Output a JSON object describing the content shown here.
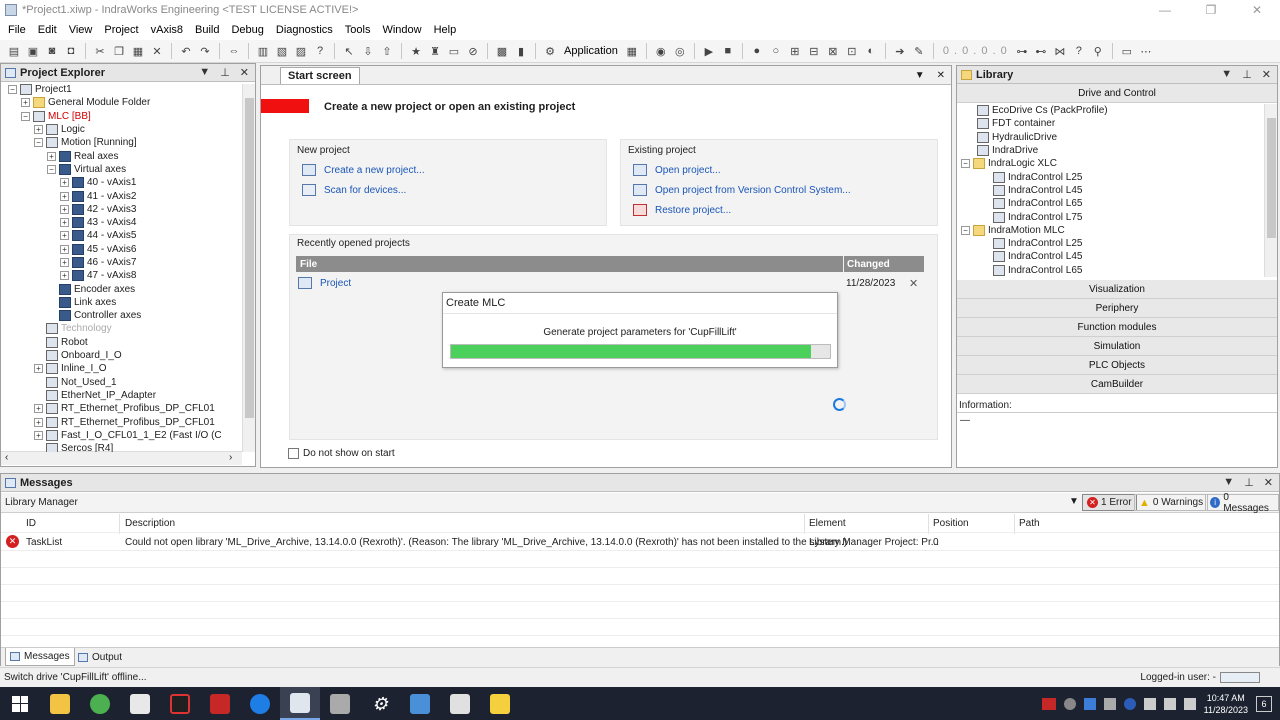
{
  "window": {
    "title": "*Project1.xiwp - IndraWorks Engineering <TEST LICENSE ACTIVE!>",
    "controls": [
      "—",
      "❐",
      "✕"
    ]
  },
  "menu": [
    "File",
    "Edit",
    "View",
    "Project",
    "vAxis8",
    "Build",
    "Debug",
    "Diagnostics",
    "Tools",
    "Window",
    "Help"
  ],
  "toolbar": {
    "application_label": "Application",
    "address_display": "0 . 0 . 0 . 0"
  },
  "project_explorer": {
    "title": "Project Explorer",
    "items": [
      {
        "label": "Project1",
        "indent": 0,
        "exp": "−",
        "icon": "project"
      },
      {
        "label": "General Module Folder",
        "indent": 1,
        "exp": "+",
        "icon": "folder"
      },
      {
        "label": "MLC [BB]",
        "indent": 1,
        "exp": "−",
        "icon": "mlc",
        "style": "red"
      },
      {
        "label": "Logic",
        "indent": 2,
        "exp": "+",
        "icon": "logic"
      },
      {
        "label": "Motion [Running]",
        "indent": 2,
        "exp": "−",
        "icon": "motion"
      },
      {
        "label": "Real axes",
        "indent": 3,
        "exp": "+",
        "icon": "axis"
      },
      {
        "label": "Virtual axes",
        "indent": 3,
        "exp": "−",
        "icon": "axis"
      },
      {
        "label": "40 - vAxis1",
        "indent": 4,
        "exp": "+",
        "icon": "axis"
      },
      {
        "label": "41 - vAxis2",
        "indent": 4,
        "exp": "+",
        "icon": "axis"
      },
      {
        "label": "42 - vAxis3",
        "indent": 4,
        "exp": "+",
        "icon": "axis"
      },
      {
        "label": "43 - vAxis4",
        "indent": 4,
        "exp": "+",
        "icon": "axis"
      },
      {
        "label": "44 - vAxis5",
        "indent": 4,
        "exp": "+",
        "icon": "axis"
      },
      {
        "label": "45 - vAxis6",
        "indent": 4,
        "exp": "+",
        "icon": "axis"
      },
      {
        "label": "46 - vAxis7",
        "indent": 4,
        "exp": "+",
        "icon": "axis"
      },
      {
        "label": "47 - vAxis8",
        "indent": 4,
        "exp": "+",
        "icon": "axis"
      },
      {
        "label": "Encoder axes",
        "indent": 3,
        "exp": "",
        "icon": "axis"
      },
      {
        "label": "Link axes",
        "indent": 3,
        "exp": "",
        "icon": "axis"
      },
      {
        "label": "Controller axes",
        "indent": 3,
        "exp": "",
        "icon": "axis"
      },
      {
        "label": "Technology",
        "indent": 2,
        "exp": "",
        "icon": "tech",
        "style": "grey"
      },
      {
        "label": "Robot",
        "indent": 2,
        "exp": "",
        "icon": "robot"
      },
      {
        "label": "Onboard_I_O",
        "indent": 2,
        "exp": "",
        "icon": "io"
      },
      {
        "label": "Inline_I_O",
        "indent": 2,
        "exp": "+",
        "icon": "io"
      },
      {
        "label": "Not_Used_1",
        "indent": 2,
        "exp": "",
        "icon": "io"
      },
      {
        "label": "EtherNet_IP_Adapter",
        "indent": 2,
        "exp": "",
        "icon": "eip"
      },
      {
        "label": "RT_Ethernet_Profibus_DP_CFL01",
        "indent": 2,
        "exp": "+",
        "icon": "net"
      },
      {
        "label": "RT_Ethernet_Profibus_DP_CFL01",
        "indent": 2,
        "exp": "+",
        "icon": "net"
      },
      {
        "label": "Fast_I_O_CFL01_1_E2 (Fast I/O (C",
        "indent": 2,
        "exp": "+",
        "icon": "net"
      },
      {
        "label": "Sercos [R4]",
        "indent": 2,
        "exp": "",
        "icon": "sercos"
      }
    ]
  },
  "start_screen": {
    "tab": "Start screen",
    "heading": "Create a new project or open an existing project",
    "accent_color": "#f01010",
    "new_project": {
      "title": "New project",
      "links": [
        "Create a new project...",
        "Scan for devices..."
      ]
    },
    "existing_project": {
      "title": "Existing project",
      "links": [
        "Open project...",
        "Open project from Version Control System...",
        "Restore project..."
      ]
    },
    "recent": {
      "title": "Recently opened projects",
      "col_file": "File",
      "col_changed": "Changed",
      "rows": [
        {
          "file": "Project",
          "changed": "11/28/2023"
        }
      ]
    },
    "checkbox_label": "Do not show on start"
  },
  "dialog": {
    "title": "Create MLC",
    "message": "Generate project parameters for 'CupFillLift'",
    "progress": 0.95,
    "progress_color": "#4cd05c"
  },
  "library": {
    "title": "Library",
    "top_band": "Drive and Control",
    "items": [
      {
        "label": "EcoDrive Cs (PackProfile)",
        "indent": 1
      },
      {
        "label": "FDT container",
        "indent": 1
      },
      {
        "label": "HydraulicDrive",
        "indent": 1
      },
      {
        "label": "IndraDrive",
        "indent": 1
      },
      {
        "label": "IndraLogic XLC",
        "indent": 0,
        "exp": "−"
      },
      {
        "label": "IndraControl L25",
        "indent": 2
      },
      {
        "label": "IndraControl L45",
        "indent": 2
      },
      {
        "label": "IndraControl L65",
        "indent": 2
      },
      {
        "label": "IndraControl L75",
        "indent": 2
      },
      {
        "label": "IndraMotion MLC",
        "indent": 0,
        "exp": "−"
      },
      {
        "label": "IndraControl L25",
        "indent": 2
      },
      {
        "label": "IndraControl L45",
        "indent": 2
      },
      {
        "label": "IndraControl L65",
        "indent": 2
      }
    ],
    "bands": [
      "Visualization",
      "Periphery",
      "Function modules",
      "Simulation",
      "PLC Objects",
      "CamBuilder"
    ],
    "info_label": "Information:",
    "info_value": "—"
  },
  "messages": {
    "title": "Messages",
    "source": "Library Manager",
    "errors": "1 Error",
    "warnings": "0 Warnings",
    "msgs": "0 Messages",
    "columns": {
      "id": "ID",
      "description": "Description",
      "element": "Element",
      "position": "Position",
      "path": "Path"
    },
    "rows": [
      {
        "id": "TaskList",
        "description": "Could not open library 'ML_Drive_Archive, 13.14.0.0 (Rexroth)'. (Reason: The library 'ML_Drive_Archive, 13.14.0.0 (Rexroth)' has not been installed to the system.)",
        "element": "Library Manager Project: Pr...",
        "position": "0",
        "path": ""
      }
    ],
    "tabs": [
      "Messages",
      "Output"
    ]
  },
  "status": {
    "text": "Switch drive 'CupFillLift' offline...",
    "login": "Logged-in user: -"
  },
  "taskbar": {
    "time": "10:47 AM",
    "date": "11/28/2023",
    "notification_count": "6"
  }
}
